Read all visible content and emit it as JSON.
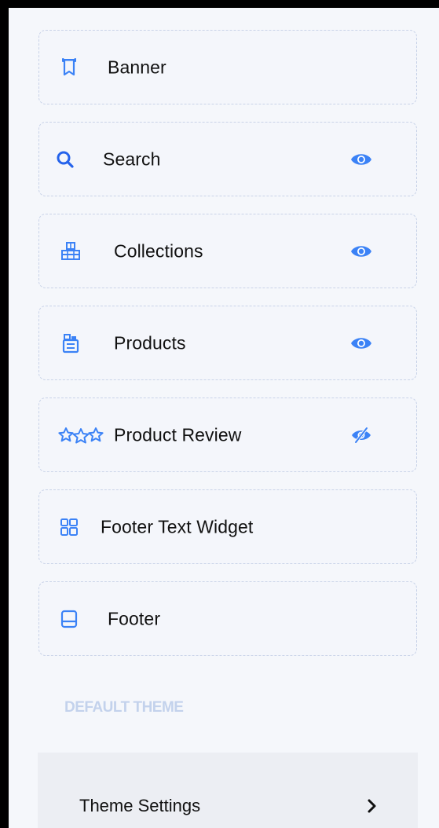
{
  "sections": [
    {
      "label": "Banner",
      "icon": "banner-icon",
      "visibility": "none"
    },
    {
      "label": "Search",
      "icon": "search-icon",
      "visibility": "visible"
    },
    {
      "label": "Collections",
      "icon": "collections-icon",
      "visibility": "visible"
    },
    {
      "label": "Products",
      "icon": "products-icon",
      "visibility": "visible"
    },
    {
      "label": "Product Review",
      "icon": "stars-icon",
      "visibility": "hidden"
    },
    {
      "label": "Footer Text Widget",
      "icon": "grid-widget-icon",
      "visibility": "none"
    },
    {
      "label": "Footer",
      "icon": "footer-icon",
      "visibility": "none"
    }
  ],
  "default_theme": {
    "heading": "DEFAULT THEME",
    "settings_label": "Theme Settings"
  },
  "colors": {
    "accent": "#3b82f6",
    "card_border": "#c9d3e8",
    "heading": "#c3d2ec"
  }
}
